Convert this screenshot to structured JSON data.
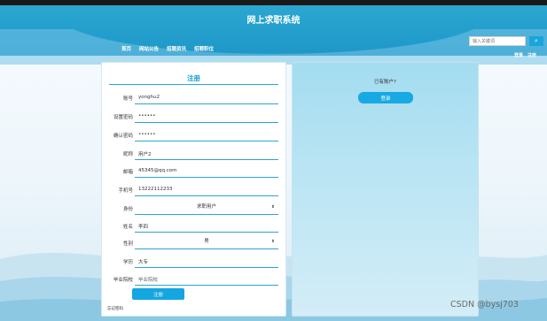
{
  "header": {
    "title": "网上求职系统",
    "nav": [
      "首页",
      "网站公告",
      "招聘资讯",
      "招聘职位"
    ],
    "search_placeholder": "输入关键词",
    "search_icon": "search-icon",
    "links": [
      "登录",
      "注册"
    ]
  },
  "register": {
    "title": "注册",
    "fields": [
      {
        "label": "账号",
        "value": "yonghu2",
        "type": "text"
      },
      {
        "label": "设置密码",
        "value": "••••••",
        "type": "password"
      },
      {
        "label": "确认密码",
        "value": "••••••",
        "type": "password"
      },
      {
        "label": "昵称",
        "value": "用户2",
        "type": "text"
      },
      {
        "label": "邮箱",
        "value": "45345@qq.com",
        "type": "text"
      },
      {
        "label": "手机号",
        "value": "13222112233",
        "type": "text"
      },
      {
        "label": "身份",
        "value": "求职用户",
        "type": "select"
      },
      {
        "label": "姓名",
        "value": "李四",
        "type": "text"
      },
      {
        "label": "性别",
        "value": "男",
        "type": "select"
      },
      {
        "label": "学历",
        "value": "大专",
        "type": "text"
      },
      {
        "label": "毕业院校",
        "value": "毕业院校",
        "type": "placeholder"
      }
    ],
    "submit": "注册",
    "forgot": "忘记密码"
  },
  "login_panel": {
    "prompt": "已有账户?",
    "button": "登录"
  },
  "watermark": "CSDN @bysj703",
  "colors": {
    "header": "#1e97c7",
    "accent": "#14a6e0",
    "line": "#2ba4d2"
  }
}
